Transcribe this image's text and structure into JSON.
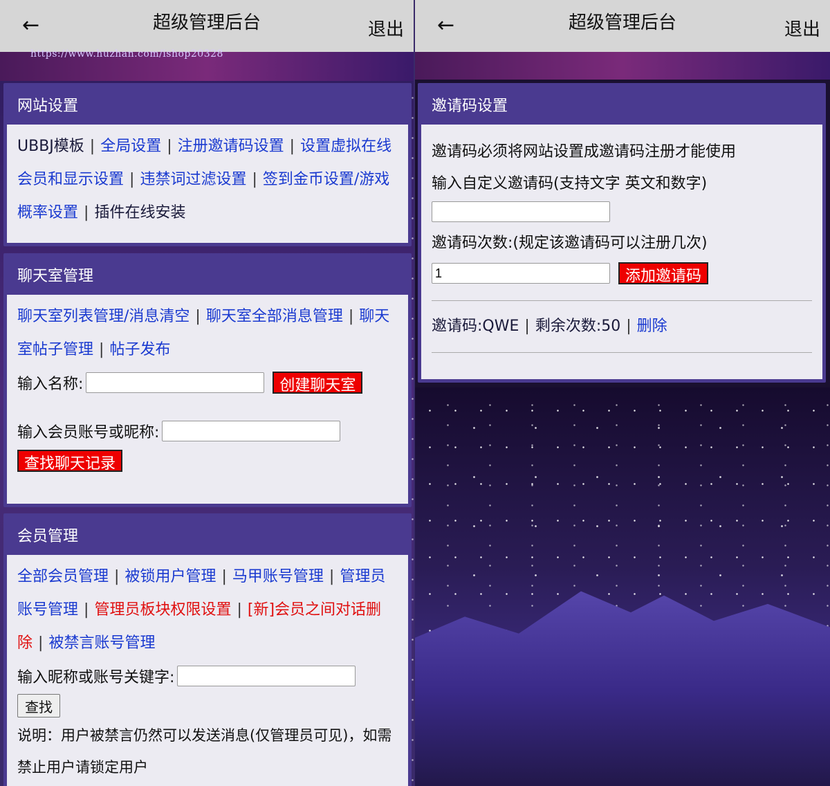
{
  "left": {
    "header": {
      "back_icon": "←",
      "title": "超级管理后台",
      "logout": "退出"
    },
    "watermark": "https://www.huzhan.com/ishop20328",
    "site_settings": {
      "title": "网站设置",
      "links": [
        {
          "label": "UBBJ模板",
          "style": "plain"
        },
        {
          "label": "全局设置",
          "style": "link"
        },
        {
          "label": "注册邀请码设置",
          "style": "link"
        },
        {
          "label": "设置虚拟在线会员和显示设置",
          "style": "link"
        },
        {
          "label": "违禁词过滤设置",
          "style": "link"
        },
        {
          "label": "签到金币设置/游戏概率设置",
          "style": "link"
        },
        {
          "label": "插件在线安装",
          "style": "plain"
        }
      ]
    },
    "chatroom": {
      "title": "聊天室管理",
      "links": [
        {
          "label": "聊天室列表管理/消息清空",
          "style": "link"
        },
        {
          "label": "聊天室全部消息管理",
          "style": "link"
        },
        {
          "label": "聊天室帖子管理",
          "style": "link"
        },
        {
          "label": "帖子发布",
          "style": "link"
        }
      ],
      "name_label": "输入名称:",
      "name_value": "",
      "create_button": "创建聊天室",
      "member_label": "输入会员账号或昵称:",
      "member_value": "",
      "find_button": "查找聊天记录"
    },
    "members": {
      "title": "会员管理",
      "links": [
        {
          "label": "全部会员管理",
          "style": "link"
        },
        {
          "label": "被锁用户管理",
          "style": "link"
        },
        {
          "label": "马甲账号管理",
          "style": "link"
        },
        {
          "label": "管理员账号管理",
          "style": "link"
        },
        {
          "label": "管理员板块权限设置",
          "style": "red"
        },
        {
          "label": "[新]会员之间对话删除",
          "style": "red"
        },
        {
          "label": "被禁言账号管理",
          "style": "link"
        }
      ],
      "search_label": "输入昵称或账号关键字:",
      "search_value": "",
      "search_button": "查找",
      "note": "说明：用户被禁言仍然可以发送消息(仅管理员可见)，如需禁止用户请锁定用户"
    }
  },
  "right": {
    "header": {
      "back_icon": "←",
      "title": "超级管理后台",
      "logout": "退出"
    },
    "invite": {
      "title": "邀请码设置",
      "notice": "邀请码必须将网站设置成邀请码注册才能使用",
      "custom_label": "输入自定义邀请码(支持文字 英文和数字)",
      "custom_value": "",
      "count_label": "邀请码次数:(规定该邀请码可以注册几次)",
      "count_value": "1",
      "add_button": "添加邀请码",
      "code_label": "邀请码:QWE",
      "remaining_label": "剩余次数:50",
      "delete_link": "删除"
    }
  }
}
